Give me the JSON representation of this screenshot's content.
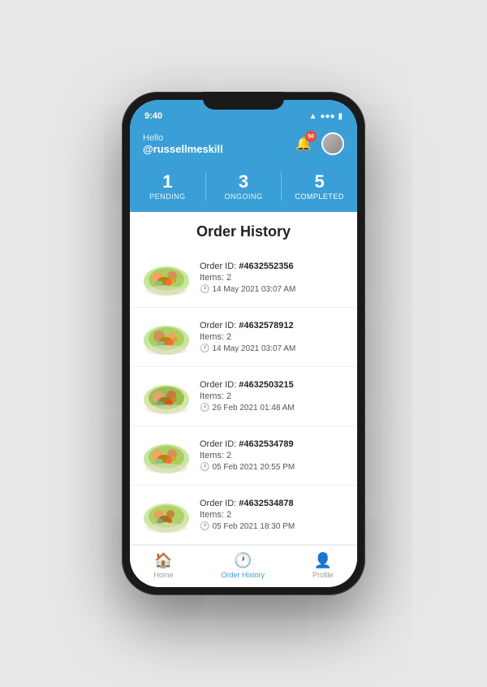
{
  "statusBar": {
    "time": "9:40",
    "icons": [
      "wifi",
      "battery"
    ]
  },
  "header": {
    "greeting": "Hello",
    "username": "@russellmeskill",
    "notificationCount": "50"
  },
  "stats": [
    {
      "number": "1",
      "label": "PENDING",
      "active": false
    },
    {
      "number": "3",
      "label": "ONGOING",
      "active": false
    },
    {
      "number": "5",
      "label": "COMPLETED",
      "active": true
    }
  ],
  "sectionTitle": "Order History",
  "orders": [
    {
      "id": "#4632552356",
      "items": "2",
      "date": "14 May 2021 03:07 AM"
    },
    {
      "id": "#4632578912",
      "items": "2",
      "date": "14 May 2021 03:07 AM"
    },
    {
      "id": "#4632503215",
      "items": "2",
      "date": "26 Feb 2021 01:48 AM"
    },
    {
      "id": "#4632534789",
      "items": "2",
      "date": "05 Feb 2021 20:55 PM"
    },
    {
      "id": "#4632534878",
      "items": "2",
      "date": "05 Feb 2021 18:30 PM"
    }
  ],
  "labels": {
    "orderId": "Order ID:",
    "items": "Items:",
    "homeNav": "Home",
    "orderHistoryNav": "Order History",
    "profileNav": "Profile"
  },
  "nav": {
    "items": [
      {
        "label": "Home",
        "active": false
      },
      {
        "label": "Order History",
        "active": true
      },
      {
        "label": "Profile",
        "active": false
      }
    ]
  }
}
